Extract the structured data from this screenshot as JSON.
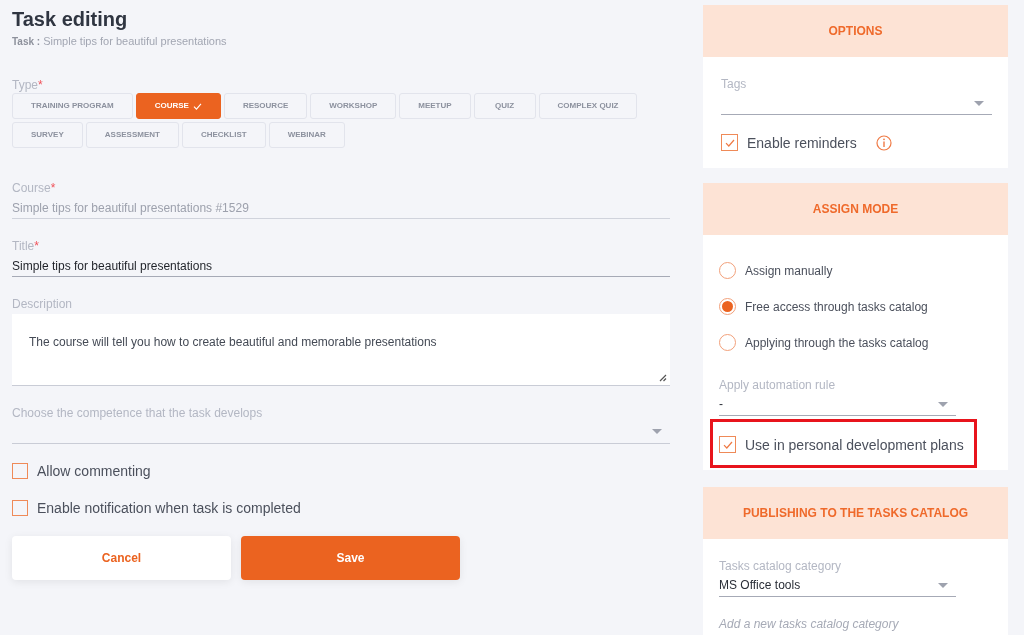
{
  "page": {
    "title": "Task editing",
    "task_label": "Task :",
    "task_name": "Simple tips for beautiful presentations"
  },
  "form": {
    "type_field": {
      "label": "Type",
      "required_mark": "*",
      "options": [
        {
          "label": "TRAINING PROGRAM",
          "selected": false
        },
        {
          "label": "COURSE",
          "selected": true
        },
        {
          "label": "RESOURCE",
          "selected": false
        },
        {
          "label": "WORKSHOP",
          "selected": false
        },
        {
          "label": "MEETUP",
          "selected": false
        },
        {
          "label": "QUIZ",
          "selected": false
        },
        {
          "label": "COMPLEX QUIZ",
          "selected": false
        },
        {
          "label": "SURVEY",
          "selected": false
        },
        {
          "label": "ASSESSMENT",
          "selected": false
        },
        {
          "label": "CHECKLIST",
          "selected": false
        },
        {
          "label": "WEBINAR",
          "selected": false
        }
      ]
    },
    "fields": [
      {
        "kind": "text",
        "label": "Course",
        "required_mark": "*",
        "value": "Simple tips for beautiful presentations #1529",
        "disabled": true
      },
      {
        "kind": "text",
        "label": "Title",
        "required_mark": "*",
        "value": "Simple tips for beautiful presentations",
        "disabled": false
      },
      {
        "kind": "textarea",
        "label": "Description",
        "value": "The course will tell you how to create beautiful and memorable presentations",
        "disabled": false
      },
      {
        "kind": "select",
        "label": "Choose the competence that the task develops",
        "disabled": false
      }
    ],
    "checkboxes": [
      {
        "label": "Allow commenting",
        "checked": false
      },
      {
        "label": "Enable notification when task is completed",
        "checked": false
      }
    ],
    "buttons": [
      {
        "label": "Cancel",
        "kind": "secondary"
      },
      {
        "label": "Save",
        "kind": "primary"
      }
    ]
  },
  "options": {
    "title": "OPTIONS",
    "tags": {
      "label": "Tags"
    },
    "reminders": {
      "label": "Enable reminders",
      "checked": true
    }
  },
  "assign_mode": {
    "title": "ASSIGN MODE",
    "radios": [
      {
        "label": "Assign manually",
        "selected": false
      },
      {
        "label": "Free access through tasks catalog",
        "selected": true
      },
      {
        "label": "Applying through the tasks catalog",
        "selected": false
      }
    ],
    "automation_rule": {
      "label": "Apply automation rule",
      "value": "-"
    },
    "pdp": {
      "label": "Use in personal development plans",
      "checked": true,
      "highlighted": true
    }
  },
  "publishing": {
    "title": "PUBLISHING TO THE TASKS CATALOG",
    "category": {
      "label": "Tasks catalog category",
      "value": "MS Office tools"
    },
    "add_link": "Add a new tasks catalog category"
  }
}
